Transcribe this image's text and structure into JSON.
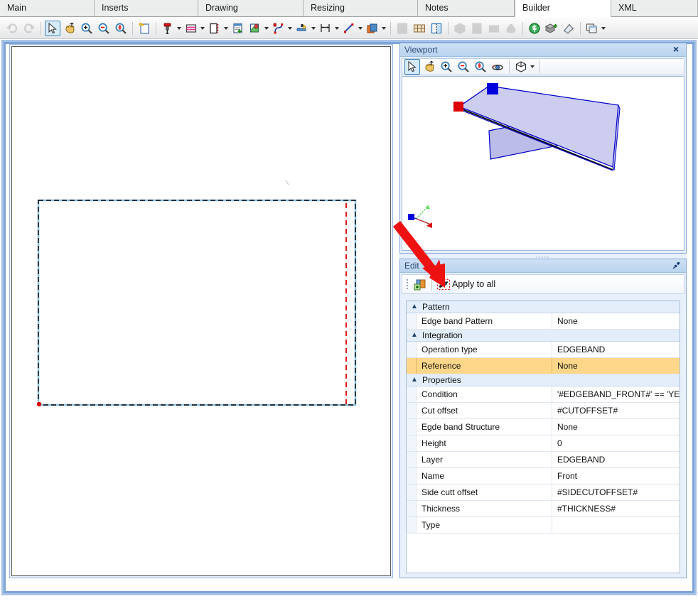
{
  "window": {
    "accent_blue": "#7fa5d8",
    "panel_header_blue": "#b9d3ef",
    "selection_orange": "#ffd78a"
  },
  "tabs": [
    {
      "label": "Main",
      "active": false
    },
    {
      "label": "Inserts",
      "active": false
    },
    {
      "label": "Drawing",
      "active": false
    },
    {
      "label": "Resizing",
      "active": false
    },
    {
      "label": "Notes",
      "active": false
    },
    {
      "label": "Builder",
      "active": true
    },
    {
      "label": "XML",
      "active": false
    }
  ],
  "main_toolbar": {
    "groups": [
      {
        "items": [
          {
            "icon": "undo-icon",
            "label": "Undo",
            "disabled": true,
            "dropdown": false,
            "selected": false
          },
          {
            "icon": "redo-icon",
            "label": "Redo",
            "disabled": true,
            "dropdown": false,
            "selected": false
          }
        ]
      },
      {
        "items": [
          {
            "icon": "select-arrow-icon",
            "label": "Select",
            "disabled": false,
            "dropdown": false,
            "selected": true
          },
          {
            "icon": "pan-hand-icon",
            "label": "Pan",
            "disabled": false,
            "dropdown": false,
            "selected": false
          },
          {
            "icon": "zoom-in-icon",
            "label": "Zoom in",
            "disabled": false,
            "dropdown": false,
            "selected": false
          },
          {
            "icon": "zoom-out-icon",
            "label": "Zoom out",
            "disabled": false,
            "dropdown": false,
            "selected": false
          },
          {
            "icon": "zoom-window-icon",
            "label": "Zoom window",
            "disabled": false,
            "dropdown": false,
            "selected": false
          }
        ]
      },
      {
        "items": [
          {
            "icon": "new-panel-icon",
            "label": "New panel",
            "disabled": false,
            "dropdown": false,
            "selected": false
          }
        ]
      },
      {
        "items": [
          {
            "icon": "drill-icon",
            "label": "Drilling",
            "disabled": false,
            "dropdown": true,
            "selected": false
          },
          {
            "icon": "groove-icon",
            "label": "Groove",
            "disabled": false,
            "dropdown": true,
            "selected": false
          },
          {
            "icon": "edgeband-icon",
            "label": "Edge band",
            "disabled": false,
            "dropdown": true,
            "selected": false
          },
          {
            "icon": "insert-icon",
            "label": "Insert",
            "disabled": false,
            "dropdown": false,
            "selected": false
          },
          {
            "icon": "pocket-icon",
            "label": "Pocket",
            "disabled": false,
            "dropdown": true,
            "selected": false
          },
          {
            "icon": "contour-icon",
            "label": "Contour",
            "disabled": false,
            "dropdown": true,
            "selected": false
          },
          {
            "icon": "rebate-icon",
            "label": "Rebate",
            "disabled": false,
            "dropdown": true,
            "selected": false
          },
          {
            "icon": "dimension-icon",
            "label": "Dimension",
            "disabled": false,
            "dropdown": true,
            "selected": false
          },
          {
            "icon": "diagonal-line-icon",
            "label": "Line",
            "disabled": false,
            "dropdown": true,
            "selected": false
          },
          {
            "icon": "layers-icon",
            "label": "Layers",
            "disabled": false,
            "dropdown": true,
            "selected": false
          }
        ]
      },
      {
        "items": [
          {
            "icon": "report-icon",
            "label": "Report",
            "disabled": true,
            "dropdown": false,
            "selected": false
          },
          {
            "icon": "nesting-icon",
            "label": "Nesting",
            "disabled": false,
            "dropdown": false,
            "selected": false
          },
          {
            "icon": "panel-split-icon",
            "label": "Panel split",
            "disabled": false,
            "dropdown": false,
            "selected": false
          }
        ]
      },
      {
        "items": [
          {
            "icon": "box-3d-icon",
            "label": "3D box",
            "disabled": true,
            "dropdown": false,
            "selected": false
          },
          {
            "icon": "cabinet-icon",
            "label": "Cabinet",
            "disabled": true,
            "dropdown": false,
            "selected": false
          },
          {
            "icon": "drawer-icon",
            "label": "Drawer",
            "disabled": true,
            "dropdown": false,
            "selected": false
          },
          {
            "icon": "money-bag-icon",
            "label": "Cost",
            "disabled": true,
            "dropdown": false,
            "selected": false
          }
        ]
      },
      {
        "items": [
          {
            "icon": "dollar-icon",
            "label": "Price",
            "disabled": false,
            "dropdown": false,
            "selected": false
          },
          {
            "icon": "copy-part-icon",
            "label": "Copy part",
            "disabled": false,
            "dropdown": false,
            "selected": false
          },
          {
            "icon": "book-icon",
            "label": "Library",
            "disabled": false,
            "dropdown": false,
            "selected": false
          }
        ]
      },
      {
        "items": [
          {
            "icon": "windows-cascade-icon",
            "label": "Windows",
            "disabled": false,
            "dropdown": true,
            "selected": false
          }
        ]
      }
    ]
  },
  "viewport": {
    "title": "Viewport",
    "close_label": "×",
    "toolbar": [
      {
        "icon": "select-arrow-icon",
        "label": "Select",
        "dropdown": false,
        "selected": true
      },
      {
        "icon": "pan-hand-icon",
        "label": "Pan",
        "dropdown": false,
        "selected": false
      },
      {
        "icon": "zoom-in-icon",
        "label": "Zoom in",
        "dropdown": false,
        "selected": false
      },
      {
        "icon": "zoom-out-icon",
        "label": "Zoom out",
        "dropdown": false,
        "selected": false
      },
      {
        "icon": "zoom-window-icon",
        "label": "Zoom all",
        "dropdown": false,
        "selected": false
      },
      {
        "icon": "orbit-icon",
        "label": "Orbit",
        "dropdown": false,
        "selected": false
      },
      {
        "icon": "view-cube-icon",
        "label": "View",
        "dropdown": true,
        "selected": false
      }
    ],
    "scene": {
      "panel_fill": "#ccccf0",
      "panel_edge": "#0000cc",
      "handle_start_color": "#0000dd",
      "handle_end_color": "#dd0000",
      "axis_x_color": "#cc0000",
      "axis_y_color": "#33cc33",
      "axis_z_color": "#0000cc"
    }
  },
  "edit_panel": {
    "title": "Edit",
    "pin_label": "Auto hide",
    "toolbar": {
      "add_icon_label": "Add operation",
      "apply_icon": "apply-to-all-icon",
      "apply_label": "Apply to all"
    },
    "property_grid": {
      "groups": [
        {
          "name": "Pattern",
          "expanded": true,
          "rows": [
            {
              "name": "Edge band Pattern",
              "value": "None",
              "selected": false
            }
          ]
        },
        {
          "name": "Integration",
          "expanded": true,
          "rows": [
            {
              "name": "Operation type",
              "value": "EDGEBAND",
              "selected": false
            },
            {
              "name": "Reference",
              "value": "None",
              "selected": true
            }
          ]
        },
        {
          "name": "Properties",
          "expanded": true,
          "rows": [
            {
              "name": "Condition",
              "value": "'#EDGEBAND_FRONT#' == 'YES'",
              "selected": false
            },
            {
              "name": "Cut offset",
              "value": "#CUTOFFSET#",
              "selected": false
            },
            {
              "name": "Egde band Structure",
              "value": "None",
              "selected": false
            },
            {
              "name": "Height",
              "value": "0",
              "selected": false
            },
            {
              "name": "Layer",
              "value": "EDGEBAND",
              "selected": false
            },
            {
              "name": "Name",
              "value": "Front",
              "selected": false
            },
            {
              "name": "Side cutt offset",
              "value": "#SIDECUTOFFSET#",
              "selected": false
            },
            {
              "name": "Thickness",
              "value": "#THICKNESS#",
              "selected": false
            },
            {
              "name": "Type",
              "value": "",
              "selected": false
            }
          ]
        }
      ]
    }
  },
  "drawing_canvas": {
    "panel_outline_color": "#000000",
    "highlight_outline_color": "#8ec4e8",
    "edgeband_color": "#dd0000",
    "origin_marker_color": "#dd0000"
  },
  "annotation": {
    "arrow_color": "#ee1111",
    "points_to": "apply-to-all-button"
  }
}
